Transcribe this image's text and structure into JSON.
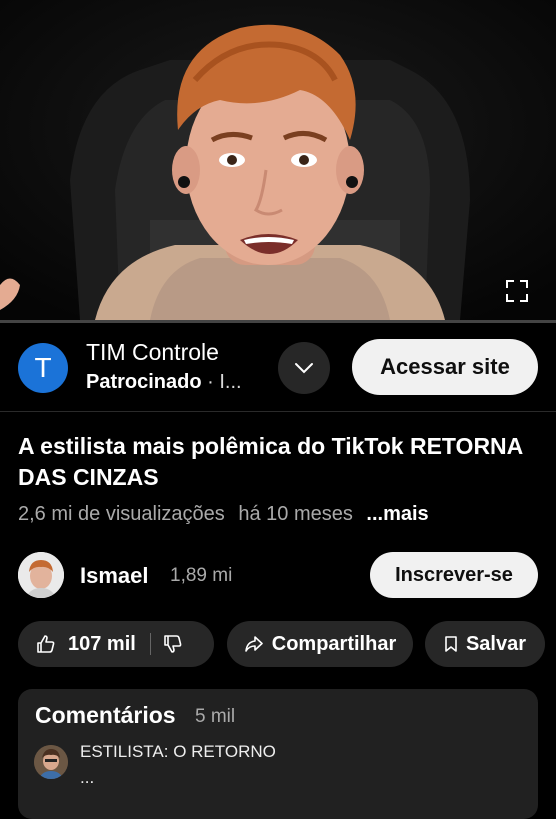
{
  "ad": {
    "logo_letter": "T",
    "title": "TIM Controle",
    "sponsored": "Patrocinado",
    "sub_rest": " · I...",
    "cta": "Acessar site"
  },
  "video": {
    "title": "A estilista mais polêmica do TikTok RETORNA DAS CINZAS",
    "views": "2,6 mi de visualizações",
    "age": "há 10 meses",
    "more": "...mais"
  },
  "channel": {
    "name": "Ismael",
    "subscribers": "1,89 mi",
    "subscribe_label": "Inscrever-se"
  },
  "actions": {
    "likes": "107 mil",
    "share": "Compartilhar",
    "save": "Salvar"
  },
  "comments": {
    "title": "Comentários",
    "count": "5 mil",
    "top_comment_line1": "ESTILISTA: O RETORNO",
    "top_comment_line2": "..."
  },
  "colors": {
    "background": "#000000",
    "chip": "#272727",
    "ad_logo": "#1b73d8",
    "button_light": "#f1f1f1"
  },
  "icons": [
    "fullscreen-icon",
    "chevron-down-icon",
    "thumbs-up-icon",
    "thumbs-down-icon",
    "share-icon",
    "bookmark-icon"
  ]
}
